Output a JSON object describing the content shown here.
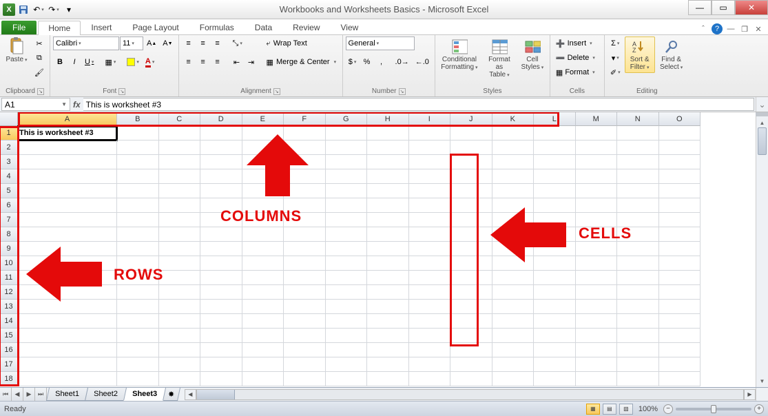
{
  "title": "Workbooks and Worksheets Basics - Microsoft Excel",
  "tabs": {
    "file": "File",
    "home": "Home",
    "insert": "Insert",
    "pagelayout": "Page Layout",
    "formulas": "Formulas",
    "data": "Data",
    "review": "Review",
    "view": "View"
  },
  "ribbon": {
    "clipboard": {
      "paste": "Paste",
      "label": "Clipboard"
    },
    "font": {
      "name": "Calibri",
      "size": "11",
      "label": "Font",
      "b": "B",
      "i": "I",
      "u": "U"
    },
    "alignment": {
      "wrap": "Wrap Text",
      "merge": "Merge & Center",
      "label": "Alignment"
    },
    "number": {
      "format": "General",
      "label": "Number",
      "cur": "$",
      "pct": "%",
      "comma": ","
    },
    "styles": {
      "cf": "Conditional Formatting",
      "fat": "Format as Table",
      "cs": "Cell Styles",
      "label": "Styles"
    },
    "cells": {
      "insert": "Insert",
      "delete": "Delete",
      "format": "Format",
      "label": "Cells"
    },
    "editing": {
      "sf": "Sort & Filter",
      "fs": "Find & Select",
      "label": "Editing",
      "sigma": "Σ"
    }
  },
  "formula_bar": {
    "name": "A1",
    "fx": "fx",
    "value": "This is worksheet #3"
  },
  "grid": {
    "columns": [
      "A",
      "B",
      "C",
      "D",
      "E",
      "F",
      "G",
      "H",
      "I",
      "J",
      "K",
      "L",
      "M",
      "N",
      "O"
    ],
    "rows": [
      "1",
      "2",
      "3",
      "4",
      "5",
      "6",
      "7",
      "8",
      "9",
      "10",
      "11",
      "12",
      "13",
      "14",
      "15",
      "16",
      "17",
      "18"
    ],
    "a1": "This is worksheet #3"
  },
  "annotations": {
    "cols": "COLUMNS",
    "rows": "ROWS",
    "cells": "CELLS"
  },
  "sheets": {
    "s1": "Sheet1",
    "s2": "Sheet2",
    "s3": "Sheet3"
  },
  "status": {
    "ready": "Ready",
    "zoom": "100%"
  }
}
